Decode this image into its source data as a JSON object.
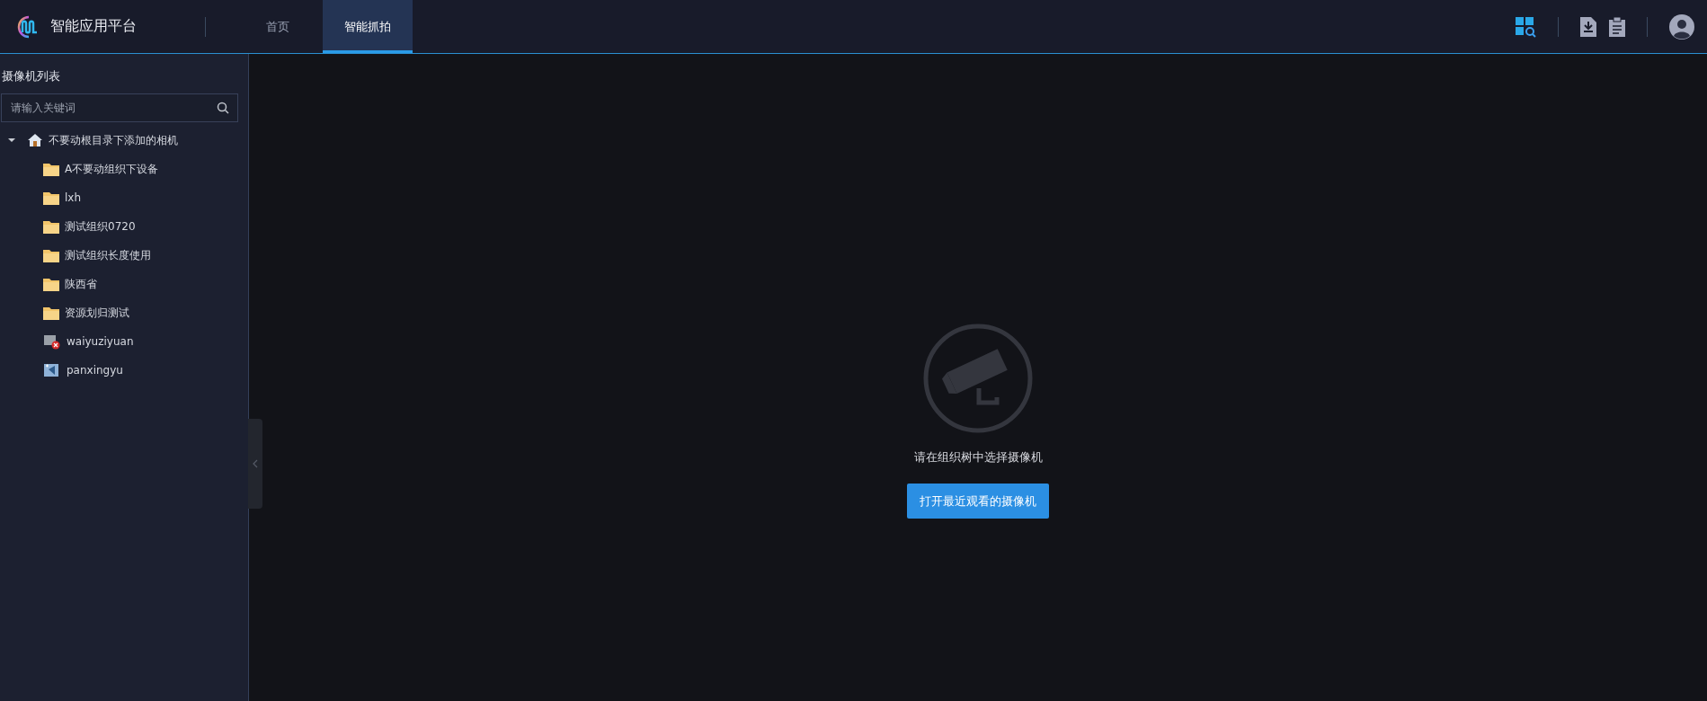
{
  "header": {
    "app_title": "智能应用平台",
    "nav": [
      {
        "label": "首页",
        "selected": false
      },
      {
        "label": "智能抓拍",
        "selected": true
      }
    ]
  },
  "sidebar": {
    "title": "摄像机列表",
    "search": {
      "placeholder": "请输入关键词"
    },
    "tree": [
      {
        "label": "不要动根目录下添加的相机",
        "kind": "home",
        "expanded": true,
        "children": [
          {
            "label": "A不要动组织下设备",
            "kind": "folder"
          },
          {
            "label": "lxh",
            "kind": "folder"
          },
          {
            "label": "测试组织0720",
            "kind": "folder"
          },
          {
            "label": "测试组织长度使用",
            "kind": "folder"
          },
          {
            "label": "陕西省",
            "kind": "folder"
          },
          {
            "label": "资源划归测试",
            "kind": "folder"
          },
          {
            "label": "waiyuziyuan",
            "kind": "camera-offline"
          },
          {
            "label": "panxingyu",
            "kind": "camera"
          }
        ]
      }
    ]
  },
  "main": {
    "message": "请在组织树中选择摄像机",
    "button": "打开最近观看的摄像机"
  }
}
